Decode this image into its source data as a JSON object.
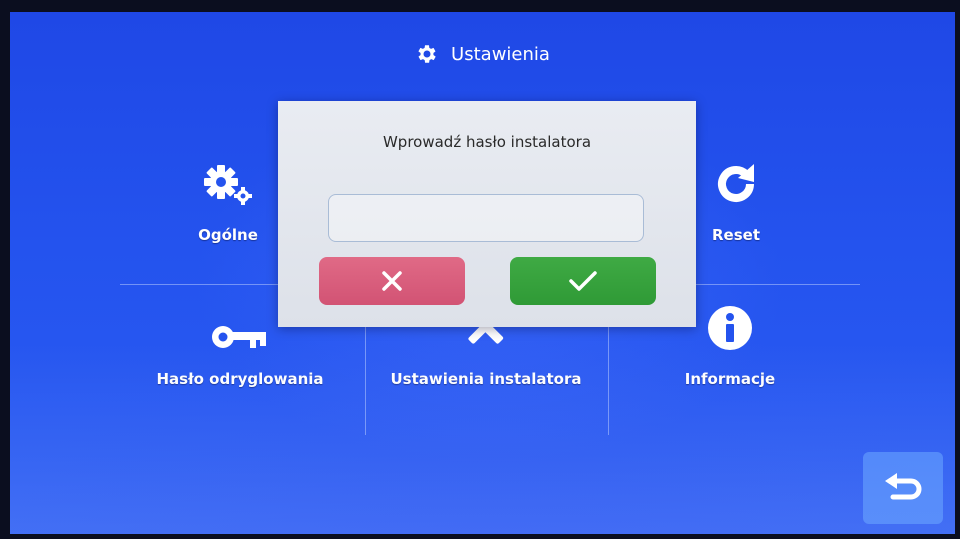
{
  "header": {
    "title": "Ustawienia",
    "icon": "gear-icon"
  },
  "menu": [
    {
      "id": "general",
      "label": "Ogólne",
      "icon": "gears-icon"
    },
    {
      "id": "reset",
      "label": "Reset",
      "icon": "refresh-icon"
    },
    {
      "id": "unlock-password",
      "label": "Hasło odryglowania",
      "icon": "key-icon"
    },
    {
      "id": "installer-settings",
      "label": "Ustawienia instalatora",
      "icon": "tools-icon"
    },
    {
      "id": "info",
      "label": "Informacje",
      "icon": "info-icon"
    }
  ],
  "dialog": {
    "prompt": "Wprowadź hasło instalatora",
    "password_value": "",
    "cancel_icon": "close-icon",
    "confirm_icon": "check-icon"
  },
  "back_icon": "back-arrow-icon",
  "colors": {
    "background": "#2453ee",
    "dialog": "#e4e7ee",
    "cancel": "#d9607d",
    "confirm": "#36a23c"
  }
}
